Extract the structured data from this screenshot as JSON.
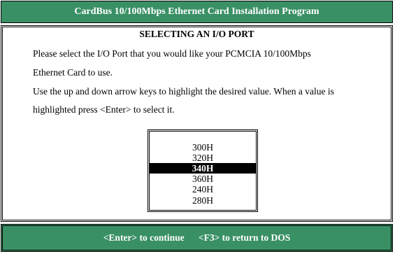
{
  "header": {
    "title": "CardBus 10/100Mbps Ethernet Card Installation Program"
  },
  "panel": {
    "title": "SELECTING AN  I/O PORT",
    "lines": [
      "Please select the I/O Port that you would like your PCMCIA 10/100Mbps",
      "Ethernet Card to use.",
      "Use the up and down arrow keys to highlight the desired value.  When a value is",
      "highlighted press <Enter> to select it."
    ]
  },
  "ports": {
    "items": [
      "300H",
      "320H",
      "340H",
      "360H",
      "240H",
      "280H"
    ],
    "selected": "340H"
  },
  "footer": {
    "continue_label": "<Enter> to continue",
    "dos_label": "<F3> to return to DOS"
  },
  "colors": {
    "accent": "#3a9065",
    "highlight": "#000000"
  }
}
